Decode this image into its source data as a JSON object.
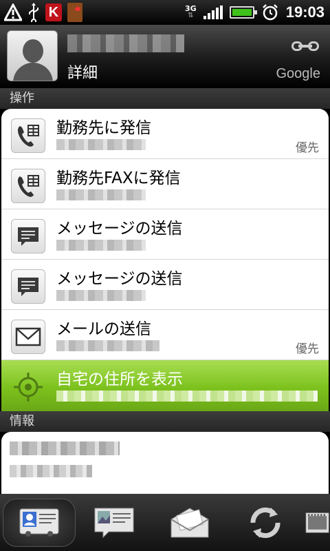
{
  "status_bar": {
    "network_type": "3G",
    "time": "19:03",
    "icons": [
      "warning-icon",
      "usb-icon",
      "k-app-icon",
      "door-app-icon",
      "signal-icon",
      "battery-icon",
      "alarm-icon"
    ]
  },
  "header": {
    "subtitle": "詳細",
    "account": "Google",
    "link_icon": "link-icon"
  },
  "sections": {
    "actions_label": "操作",
    "info_label": "情報"
  },
  "actions": [
    {
      "title": "勤務先に発信",
      "icon": "work-phone-icon",
      "tag": "優先"
    },
    {
      "title": "勤務先FAXに発信",
      "icon": "work-phone-icon",
      "tag": ""
    },
    {
      "title": "メッセージの送信",
      "icon": "message-icon",
      "tag": ""
    },
    {
      "title": "メッセージの送信",
      "icon": "message-icon",
      "tag": ""
    },
    {
      "title": "メールの送信",
      "icon": "mail-icon",
      "tag": "優先"
    },
    {
      "title": "自宅の住所を表示",
      "icon": "map-target-icon",
      "tag": ""
    }
  ],
  "bottom_tabs": [
    "contact-details-tab-icon",
    "photo-message-tab-icon",
    "mail-tab-icon",
    "sync-tab-icon",
    "media-tab-icon"
  ],
  "colors": {
    "highlight": "#7cc11d",
    "card_bg": "#ffffff",
    "section_bg": "#2e2e2e"
  }
}
